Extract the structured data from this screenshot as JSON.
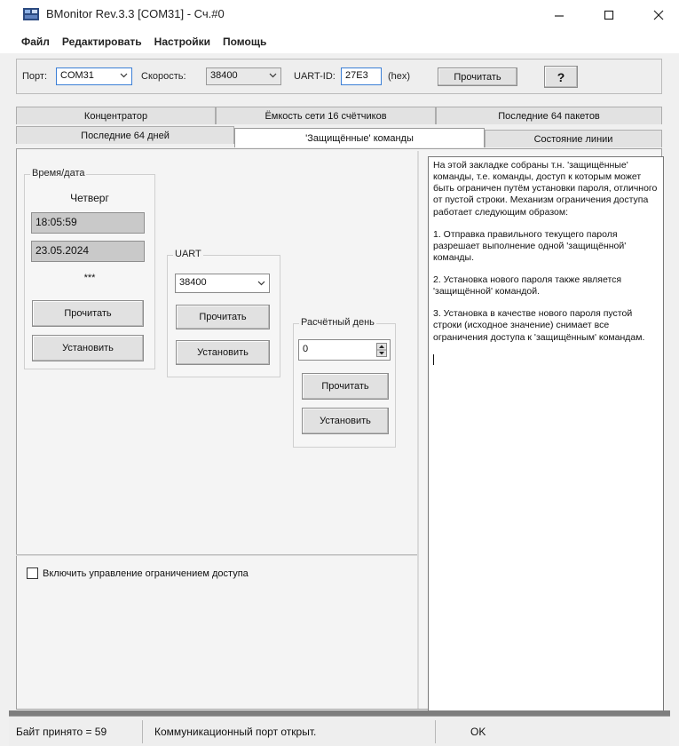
{
  "window": {
    "title": "BMonitor Rev.3.3 [COM31] - Сч.#0",
    "minimize_icon": "minimize-icon",
    "maximize_icon": "maximize-icon",
    "close_icon": "close-icon"
  },
  "menu": {
    "items": [
      "Файл",
      "Редактировать",
      "Настройки",
      "Помощь"
    ]
  },
  "toolbar": {
    "port_label": "Порт:",
    "port_value": "COM31",
    "speed_label": "Скорость:",
    "speed_value": "38400",
    "uart_id_label": "UART-ID:",
    "uart_id_value": "27E3",
    "uart_id_suffix": "(hex)",
    "read_button": "Прочитать",
    "help_button": "?"
  },
  "tabs": {
    "row1": [
      "Концентратор",
      "Ёмкость сети 16 счётчиков",
      "Последние 64 пакетов"
    ],
    "row2": [
      "Последние 64 дней",
      "'Защищённые' команды",
      "Состояние линии"
    ],
    "active": "'Защищённые' команды"
  },
  "datetime_group": {
    "title": "Время/дата",
    "weekday": "Четверг",
    "time": "18:05:59",
    "date": "23.05.2024",
    "stars": "***",
    "read_button": "Прочитать",
    "set_button": "Установить"
  },
  "uart_group": {
    "title": "UART",
    "speed_value": "38400",
    "read_button": "Прочитать",
    "set_button": "Установить"
  },
  "billing_group": {
    "title": "Расчётный день",
    "value": "0",
    "read_button": "Прочитать",
    "set_button": "Установить"
  },
  "access_control": {
    "checkbox_label": "Включить управление ограничением доступа",
    "checked": false
  },
  "info_text": {
    "p1": "На этой закладке собраны т.н. 'защищённые' команды, т.е. команды, доступ к которым может быть ограничен путём установки пароля, отличного от пустой строки. Механизм ограничения доступа работает следующим образом:",
    "p2": "1. Отправка правильного текущего пароля разрешает выполнение одной 'защищённой' команды.",
    "p3": "2. Установка нового пароля также является 'защищённой' командой.",
    "p4": "3. Установка в качестве нового пароля пустой строки (исходное значение) снимает все ограничения доступа к 'защищённым' командам."
  },
  "status": {
    "bytes_received": "Байт принято = 59",
    "port_status": "Коммуникационный порт открыт.",
    "result": "OK"
  }
}
